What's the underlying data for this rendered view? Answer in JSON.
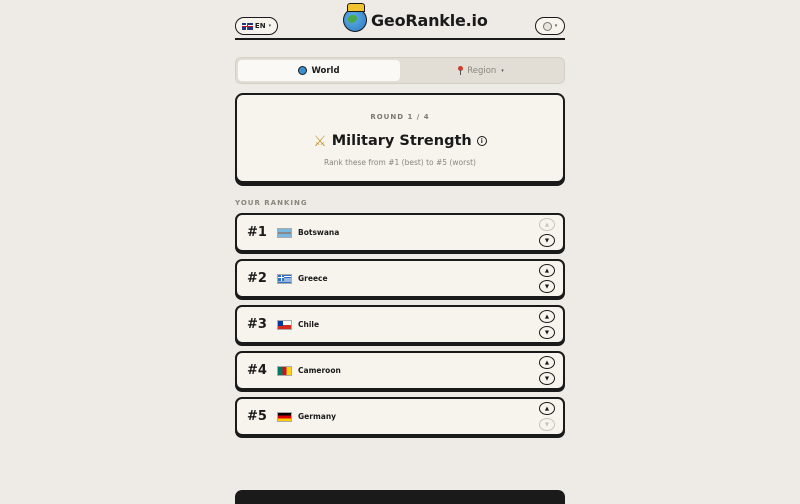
{
  "header": {
    "language": "EN",
    "app_title": "GeoRankle.io"
  },
  "tabs": [
    {
      "label": "World",
      "active": true
    },
    {
      "label": "Region",
      "active": false
    }
  ],
  "question": {
    "round": "ROUND 1 / 4",
    "title": "Military Strength",
    "subtitle": "Rank these from #1 (best) to #5 (worst)"
  },
  "ranking": {
    "label": "YOUR RANKING",
    "rows": [
      {
        "rank": "#1",
        "country": "Botswana",
        "flag": "botswana-flag-icon"
      },
      {
        "rank": "#2",
        "country": "Greece",
        "flag": "greece-flag-icon"
      },
      {
        "rank": "#3",
        "country": "Chile",
        "flag": "chile-flag-icon"
      },
      {
        "rank": "#4",
        "country": "Cameroon",
        "flag": "cameroon-flag-icon"
      },
      {
        "rank": "#5",
        "country": "Germany",
        "flag": "germany-flag-icon"
      }
    ]
  },
  "icons": {
    "up_arrow": "▲",
    "down_arrow": "▼",
    "caret": "▾",
    "info": "i"
  },
  "colors": {
    "background": "#eeebe6",
    "card": "#f7f4ee",
    "border": "#1a1a1a",
    "muted_text": "#8a857c"
  }
}
